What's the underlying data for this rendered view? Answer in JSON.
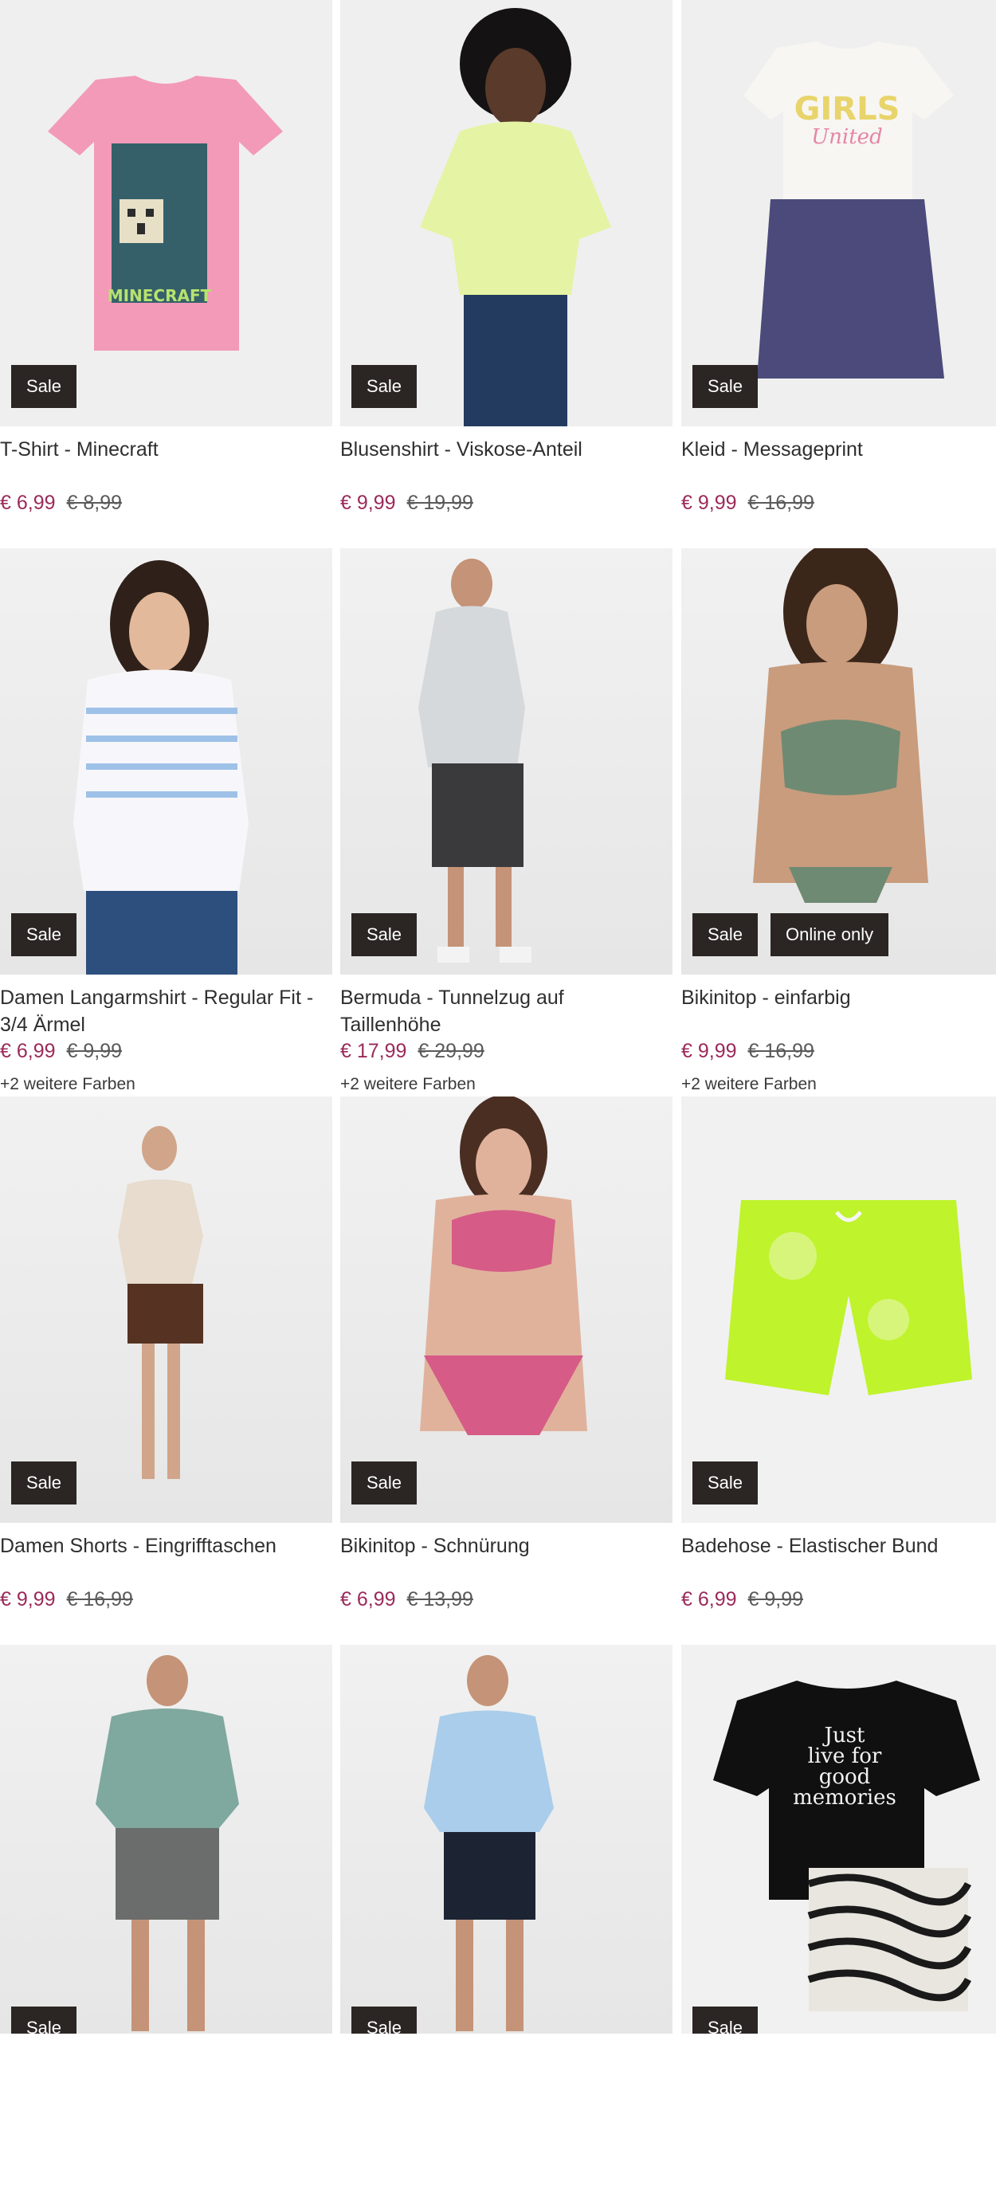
{
  "products": [
    {
      "title": "T-Shirt - Minecraft",
      "price": "€ 6,99",
      "old_price": "€ 8,99",
      "badges": [
        "Sale"
      ],
      "more": ""
    },
    {
      "title": "Blusenshirt - Viskose-Anteil",
      "price": "€ 9,99",
      "old_price": "€ 19,99",
      "badges": [
        "Sale"
      ],
      "more": ""
    },
    {
      "title": "Kleid - Messageprint",
      "price": "€ 9,99",
      "old_price": "€ 16,99",
      "badges": [
        "Sale"
      ],
      "more": ""
    },
    {
      "title": "Damen Langarmshirt - Regular Fit - 3/4 Ärmel",
      "price": "€ 6,99",
      "old_price": "€ 9,99",
      "badges": [
        "Sale"
      ],
      "more": "+2 weitere Farben"
    },
    {
      "title": "Bermuda - Tunnelzug auf Taillenhöhe",
      "price": "€ 17,99",
      "old_price": "€ 29,99",
      "badges": [
        "Sale"
      ],
      "more": "+2 weitere Farben"
    },
    {
      "title": "Bikinitop - einfarbig",
      "price": "€ 9,99",
      "old_price": "€ 16,99",
      "badges": [
        "Sale",
        "Online only"
      ],
      "more": "+2 weitere Farben"
    },
    {
      "title": "Damen Shorts - Eingrifftaschen",
      "price": "€ 9,99",
      "old_price": "€ 16,99",
      "badges": [
        "Sale"
      ],
      "more": ""
    },
    {
      "title": "Bikinitop - Schnürung",
      "price": "€ 6,99",
      "old_price": "€ 13,99",
      "badges": [
        "Sale"
      ],
      "more": ""
    },
    {
      "title": "Badehose - Elastischer Bund",
      "price": "€ 6,99",
      "old_price": "€ 9,99",
      "badges": [
        "Sale"
      ],
      "more": ""
    },
    {
      "title": "",
      "price": "",
      "old_price": "",
      "badges": [
        "Sale"
      ],
      "more": ""
    },
    {
      "title": "",
      "price": "",
      "old_price": "",
      "badges": [
        "Sale"
      ],
      "more": ""
    },
    {
      "title": "",
      "price": "",
      "old_price": "",
      "badges": [
        "Sale"
      ],
      "more": ""
    }
  ],
  "print_texts": {
    "minecraft": "MINECRAFT",
    "girls": "GIRLS",
    "united": "United",
    "memories": [
      "Just",
      "live for",
      "good",
      "memories"
    ]
  },
  "colors": {
    "sale_price": "#9b2a5a",
    "badge_bg": "#2b2523"
  }
}
